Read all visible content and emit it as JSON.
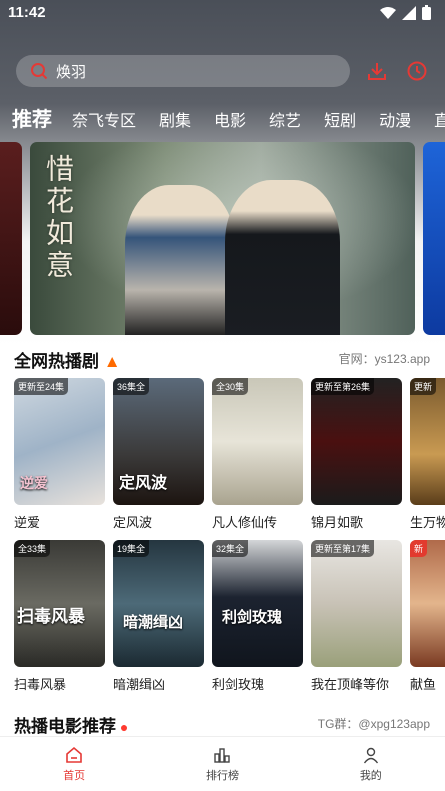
{
  "status": {
    "time": "11:42"
  },
  "search": {
    "query": "焕羽"
  },
  "tabs": [
    "推荐",
    "奈飞专区",
    "剧集",
    "电影",
    "综艺",
    "短剧",
    "动漫",
    "直"
  ],
  "banner": {
    "title_art": "惜花如意"
  },
  "section1": {
    "title": "全网热播剧",
    "link": "官网：ys123.app",
    "row1": [
      {
        "name": "逆爱",
        "badge": "更新至24集",
        "art": "逆爱"
      },
      {
        "name": "定风波",
        "badge": "36集全",
        "art": "定风波"
      },
      {
        "name": "凡人修仙传",
        "badge": "全30集",
        "art": ""
      },
      {
        "name": "锦月如歌",
        "badge": "更新至第26集",
        "art": ""
      },
      {
        "name": "生万物",
        "badge": "更新",
        "art": ""
      }
    ],
    "row2": [
      {
        "name": "扫毒风暴",
        "badge": "全33集",
        "art": "扫毒风暴"
      },
      {
        "name": "暗潮缉凶",
        "badge": "19集全",
        "art": "暗潮缉凶"
      },
      {
        "name": "利剑玫瑰",
        "badge": "32集全",
        "art": "利剑玫瑰"
      },
      {
        "name": "我在顶峰等你",
        "badge": "更新至第17集",
        "art": ""
      },
      {
        "name": "献鱼",
        "badge": "新",
        "art": ""
      }
    ]
  },
  "section2": {
    "title": "热播电影推荐",
    "link": "TG群：@xpg123app"
  },
  "nav": [
    {
      "label": "首页"
    },
    {
      "label": "排行榜"
    },
    {
      "label": "我的"
    }
  ],
  "colors": {
    "accent": "#e53935"
  }
}
